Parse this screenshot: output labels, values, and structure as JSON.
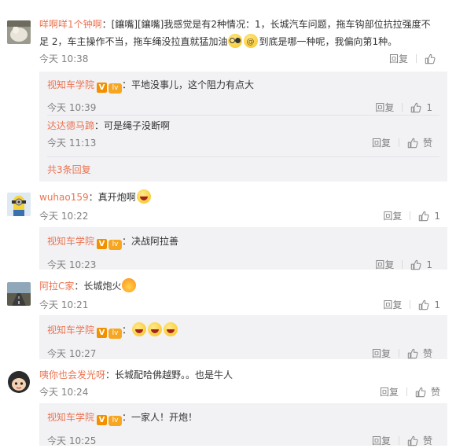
{
  "comments": [
    {
      "user": "咩啊咩1个钟啊",
      "text_a": "：[鑲嘴][鑲嘴]我感觉是有2种情况：1，长城汽车问题，拖车钩部位抗拉强度不足 2，车主操作不当，拖车绳没拉直就猛加油",
      "text_b": "到底是哪一种呢，我偏向第1种。",
      "time": "今天 10:38",
      "reply_label": "回复",
      "like_count": "",
      "replies": [
        {
          "user": "视知车学院",
          "text": "：平地没事儿，这个阻力有点大",
          "time": "今天 10:39",
          "reply_label": "回复",
          "like_count": "1"
        },
        {
          "user": "达达德马蹄",
          "text": "：可是绳子没断啊",
          "time": "今天 11:13",
          "reply_label": "回复",
          "like_label": "赞"
        }
      ],
      "more_replies": "共3条回复"
    },
    {
      "user": "wuhao159",
      "text": "：真开炮啊",
      "time": "今天 10:22",
      "reply_label": "回复",
      "like_count": "1",
      "replies": [
        {
          "user": "视知车学院",
          "text": "：决战阿拉善",
          "time": "今天 10:23",
          "reply_label": "回复",
          "like_count": "1"
        }
      ]
    },
    {
      "user": "阿拉C家",
      "text": "：长城炮火",
      "time": "今天 10:21",
      "reply_label": "回复",
      "like_count": "1",
      "replies": [
        {
          "user": "视知车学院",
          "text": "：",
          "time": "今天 10:27",
          "reply_label": "回复",
          "like_label": "赞"
        }
      ]
    },
    {
      "user": "咦你也会发光呀",
      "text": "：长城配哈佛越野。。也是牛人",
      "time": "今天 10:24",
      "reply_label": "回复",
      "like_label": "赞",
      "replies": [
        {
          "user": "视知车学院",
          "text": "：一家人！开炮！",
          "time": "今天 10:25",
          "reply_label": "回复",
          "like_label": "赞"
        }
      ]
    }
  ],
  "badges": {
    "verified": "V",
    "level": "lv"
  },
  "colors": {
    "username": "#eb7350",
    "meta": "#808080",
    "reply_bg": "#f2f2f5"
  }
}
